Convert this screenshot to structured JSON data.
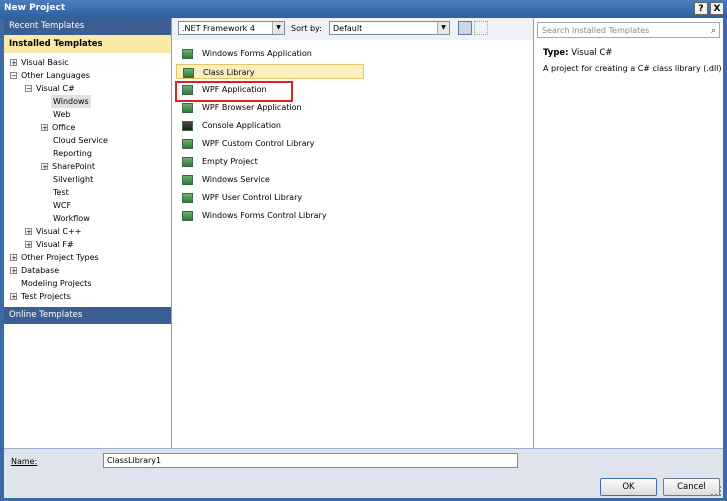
{
  "window": {
    "title": "New Project",
    "help_label": "?",
    "close_label": "X"
  },
  "left": {
    "recent_label": "Recent Templates",
    "installed_label": "Installed Templates",
    "online_label": "Online Templates",
    "tree": {
      "visual_basic": "Visual Basic",
      "other_languages": "Other Languages",
      "visual_csharp": "Visual C#",
      "windows": "Windows",
      "web": "Web",
      "office": "Office",
      "cloud_service": "Cloud Service",
      "reporting": "Reporting",
      "sharepoint": "SharePoint",
      "silverlight": "Silverlight",
      "test": "Test",
      "wcf": "WCF",
      "workflow": "Workflow",
      "visual_cpp": "Visual C++",
      "visual_fsharp": "Visual F#",
      "other_project_types": "Other Project Types",
      "database": "Database",
      "modeling_projects": "Modeling Projects",
      "test_projects": "Test Projects"
    }
  },
  "toolbar": {
    "framework": ".NET Framework 4",
    "sort_label": "Sort by:",
    "sort_value": "Default"
  },
  "templates": {
    "t0": "Windows Forms Application",
    "t1": "Class Library",
    "t2": "WPF Application",
    "t3": "WPF Browser Application",
    "t4": "Console Application",
    "t5": "WPF Custom Control Library",
    "t6": "Empty Project",
    "t7": "Windows Service",
    "t8": "WPF User Control Library",
    "t9": "Windows Forms Control Library"
  },
  "details": {
    "search_placeholder": "Search Installed Templates",
    "type_label": "Type:",
    "type_value": "Visual C#",
    "description": "A project for creating a C# class library (.dll)"
  },
  "bottom": {
    "name_label": "Name:",
    "name_value": "ClassLibrary1",
    "ok_label": "OK",
    "cancel_label": "Cancel"
  },
  "colors": {
    "title_bar": "#2f5f9e",
    "selected_template": "#fbeec0",
    "installed_highlight": "#fbe9a8",
    "red_outline": "#d22222"
  }
}
